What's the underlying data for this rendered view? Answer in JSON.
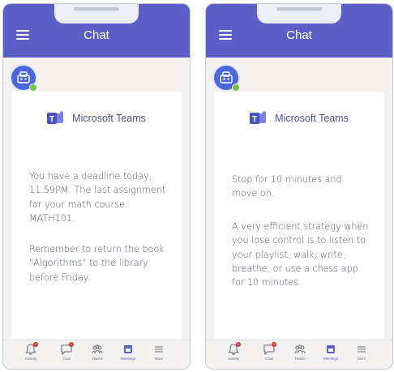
{
  "screens": [
    {
      "header": {
        "title": "Chat"
      },
      "card": {
        "brand": "Microsoft Teams",
        "paragraphs": [
          "You have a deadline today, 11.59PM. The last assignment for your math course. MATH101.",
          "Remember to return the book \"Algorithms\" to the library before Friday."
        ]
      }
    },
    {
      "header": {
        "title": "Chat"
      },
      "card": {
        "brand": "Microsoft Teams",
        "paragraphs": [
          "Stop for 10 minutes and move on.",
          "A very efficient strategy when you lose control is to listen to your playlist, walk, write, breathe, or use a chess app for 10 minutes."
        ]
      }
    }
  ],
  "tabbar": {
    "tabs": [
      {
        "label": "Activity",
        "icon": "bell-icon",
        "badge": "1"
      },
      {
        "label": "Chat",
        "icon": "chat-icon",
        "badge": "1"
      },
      {
        "label": "Teams",
        "icon": "teams-icon"
      },
      {
        "label": "Meetings",
        "icon": "calendar-icon"
      },
      {
        "label": "More",
        "icon": "more-icon"
      }
    ]
  },
  "colors": {
    "header": "#5b5fc7",
    "brand_text": "#4b4e8c",
    "body_text": "#555a6e",
    "presence": "#7bc043",
    "badge": "#d13438"
  }
}
